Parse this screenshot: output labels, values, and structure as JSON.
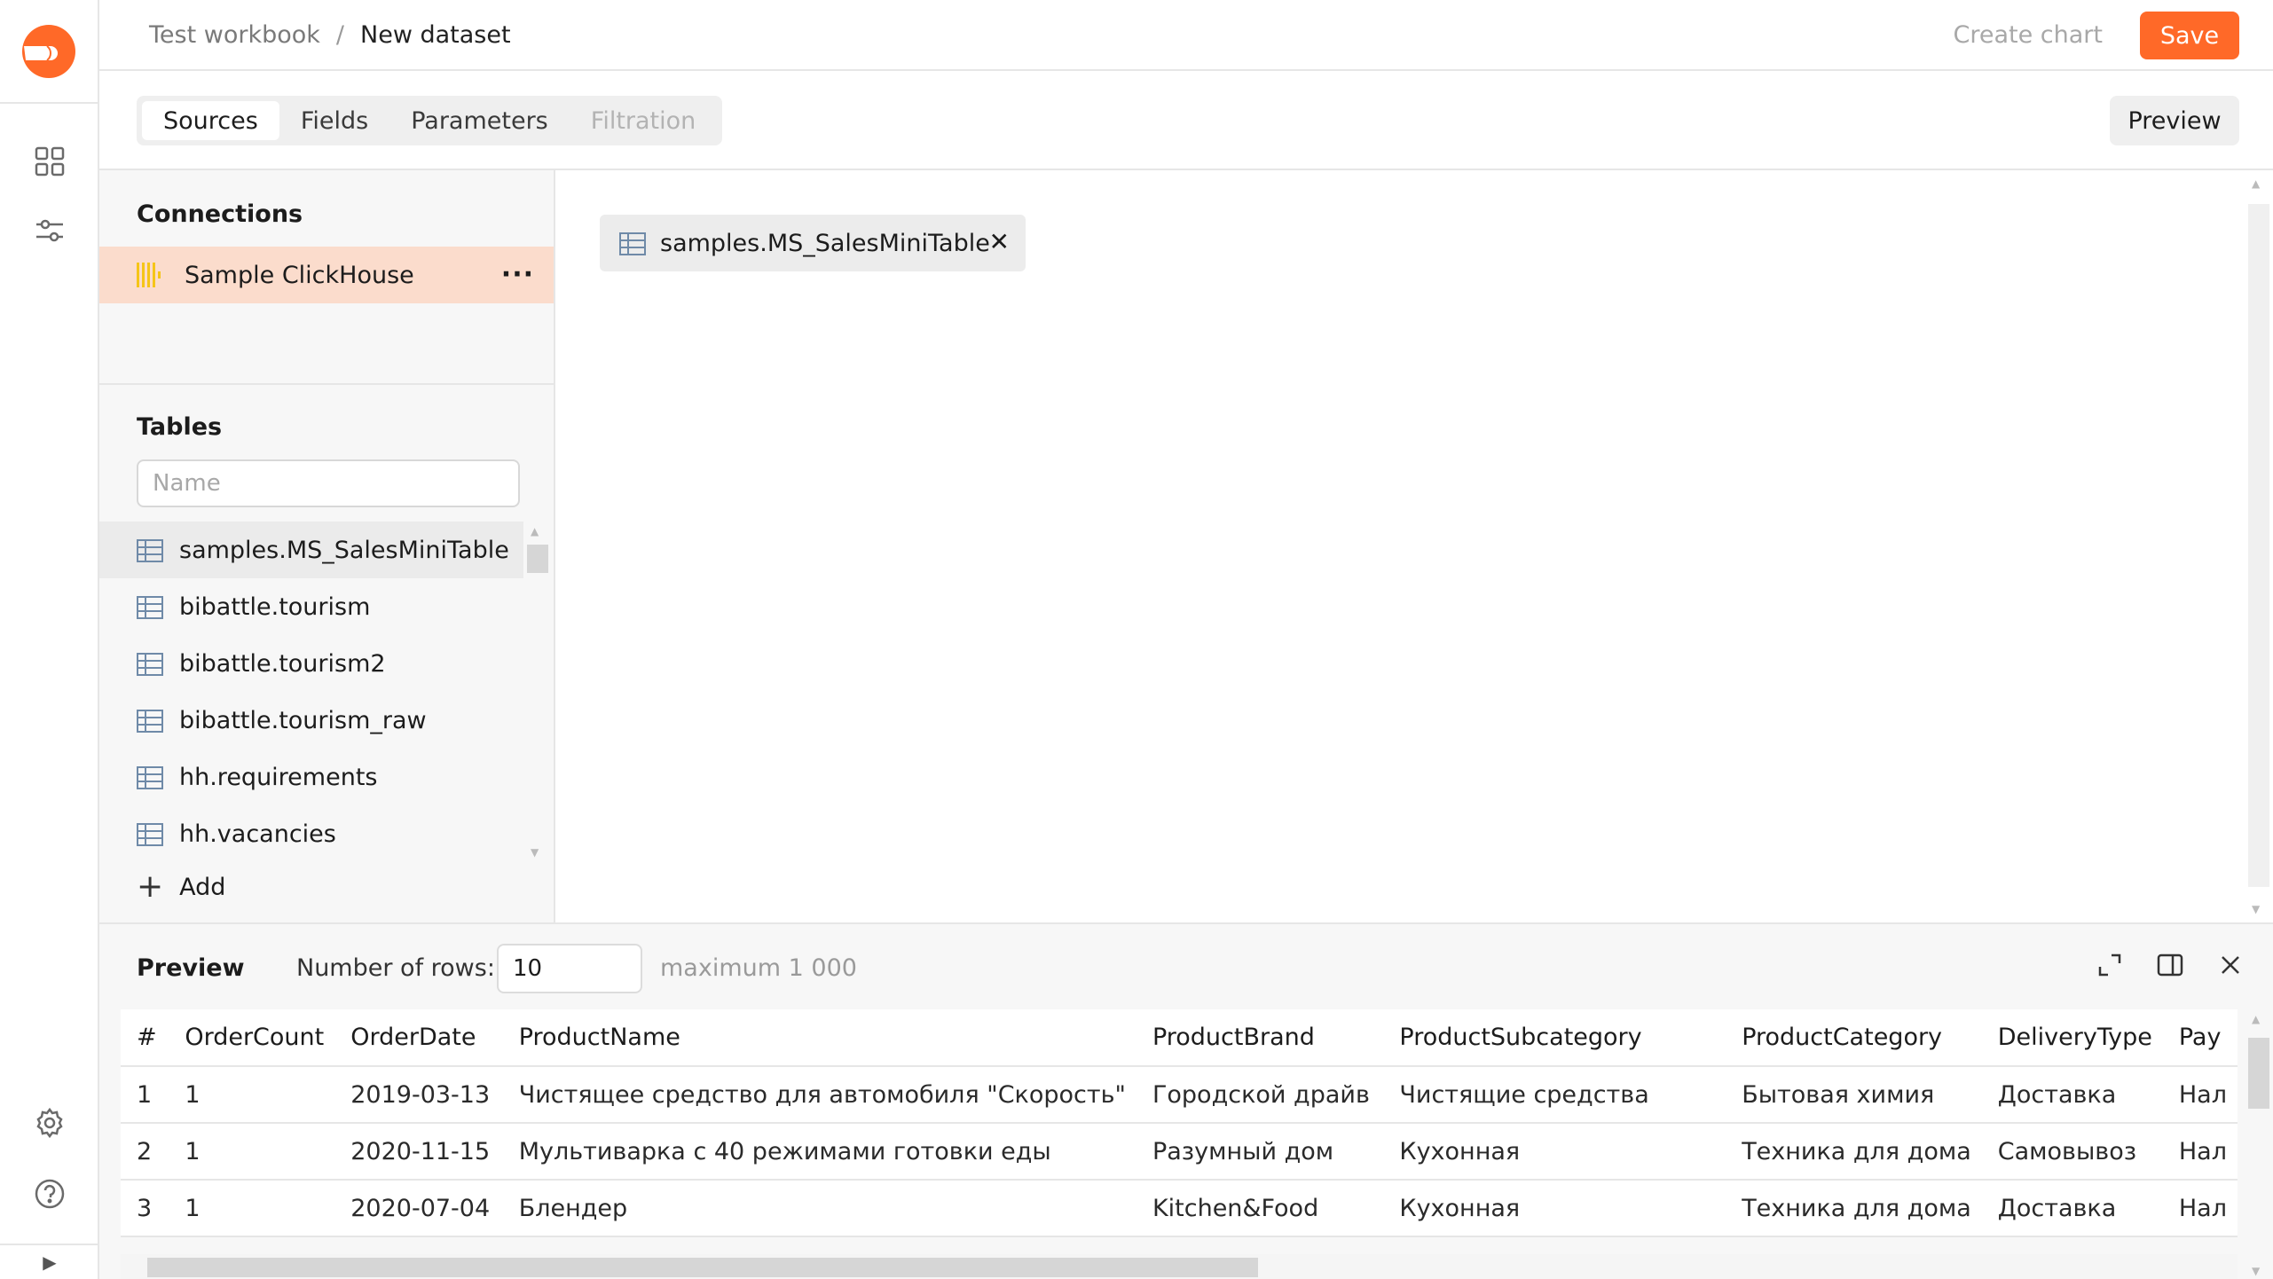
{
  "header": {
    "breadcrumb": [
      "Test workbook",
      "New dataset"
    ],
    "separator": "/",
    "create_chart_label": "Create chart",
    "save_label": "Save",
    "accent_color": "#ff6928"
  },
  "tabs": {
    "items": [
      {
        "label": "Sources",
        "state": "active"
      },
      {
        "label": "Fields",
        "state": "normal"
      },
      {
        "label": "Parameters",
        "state": "normal"
      },
      {
        "label": "Filtration",
        "state": "disabled"
      }
    ],
    "preview_label": "Preview"
  },
  "sidebar": {
    "icons": [
      "logo-icon",
      "collections-icon",
      "settings-sliders-icon",
      "gear-icon",
      "help-icon",
      "expand-arrow-icon"
    ]
  },
  "connections": {
    "title": "Connections",
    "items": [
      {
        "name": "Sample ClickHouse",
        "icon": "clickhouse-icon",
        "selected": true
      }
    ]
  },
  "tables": {
    "title": "Tables",
    "search_placeholder": "Name",
    "items": [
      {
        "name": "samples.MS_SalesMiniTable",
        "selected": true
      },
      {
        "name": "bibattle.tourism",
        "selected": false
      },
      {
        "name": "bibattle.tourism2",
        "selected": false
      },
      {
        "name": "bibattle.tourism_raw",
        "selected": false
      },
      {
        "name": "hh.requirements",
        "selected": false
      },
      {
        "name": "hh.vacancies",
        "selected": false
      }
    ],
    "add_label": "Add"
  },
  "canvas": {
    "chips": [
      {
        "name": "samples.MS_SalesMiniTable",
        "close": "✕"
      }
    ]
  },
  "preview": {
    "title": "Preview",
    "rows_label": "Number of rows:",
    "rows_value": "10",
    "rows_max": "maximum 1 000",
    "columns": [
      "#",
      "OrderCount",
      "OrderDate",
      "ProductName",
      "ProductBrand",
      "ProductSubcategory",
      "ProductCategory",
      "DeliveryType",
      "Pay"
    ],
    "rows": [
      [
        "1",
        "1",
        "2019-03-13",
        "Чистящее средство для автомобиля \"Скорость\"",
        "Городской драйв",
        "Чистящие средства",
        "Бытовая химия",
        "Доставка",
        "Нал"
      ],
      [
        "2",
        "1",
        "2020-11-15",
        "Мультиварка с 40 режимами готовки еды",
        "Разумный дом",
        "Кухонная",
        "Техника для дома",
        "Самовывоз",
        "Нал"
      ],
      [
        "3",
        "1",
        "2020-07-04",
        "Блендер",
        "Kitchen&Food",
        "Кухонная",
        "Техника для дома",
        "Доставка",
        "Нал"
      ]
    ]
  }
}
